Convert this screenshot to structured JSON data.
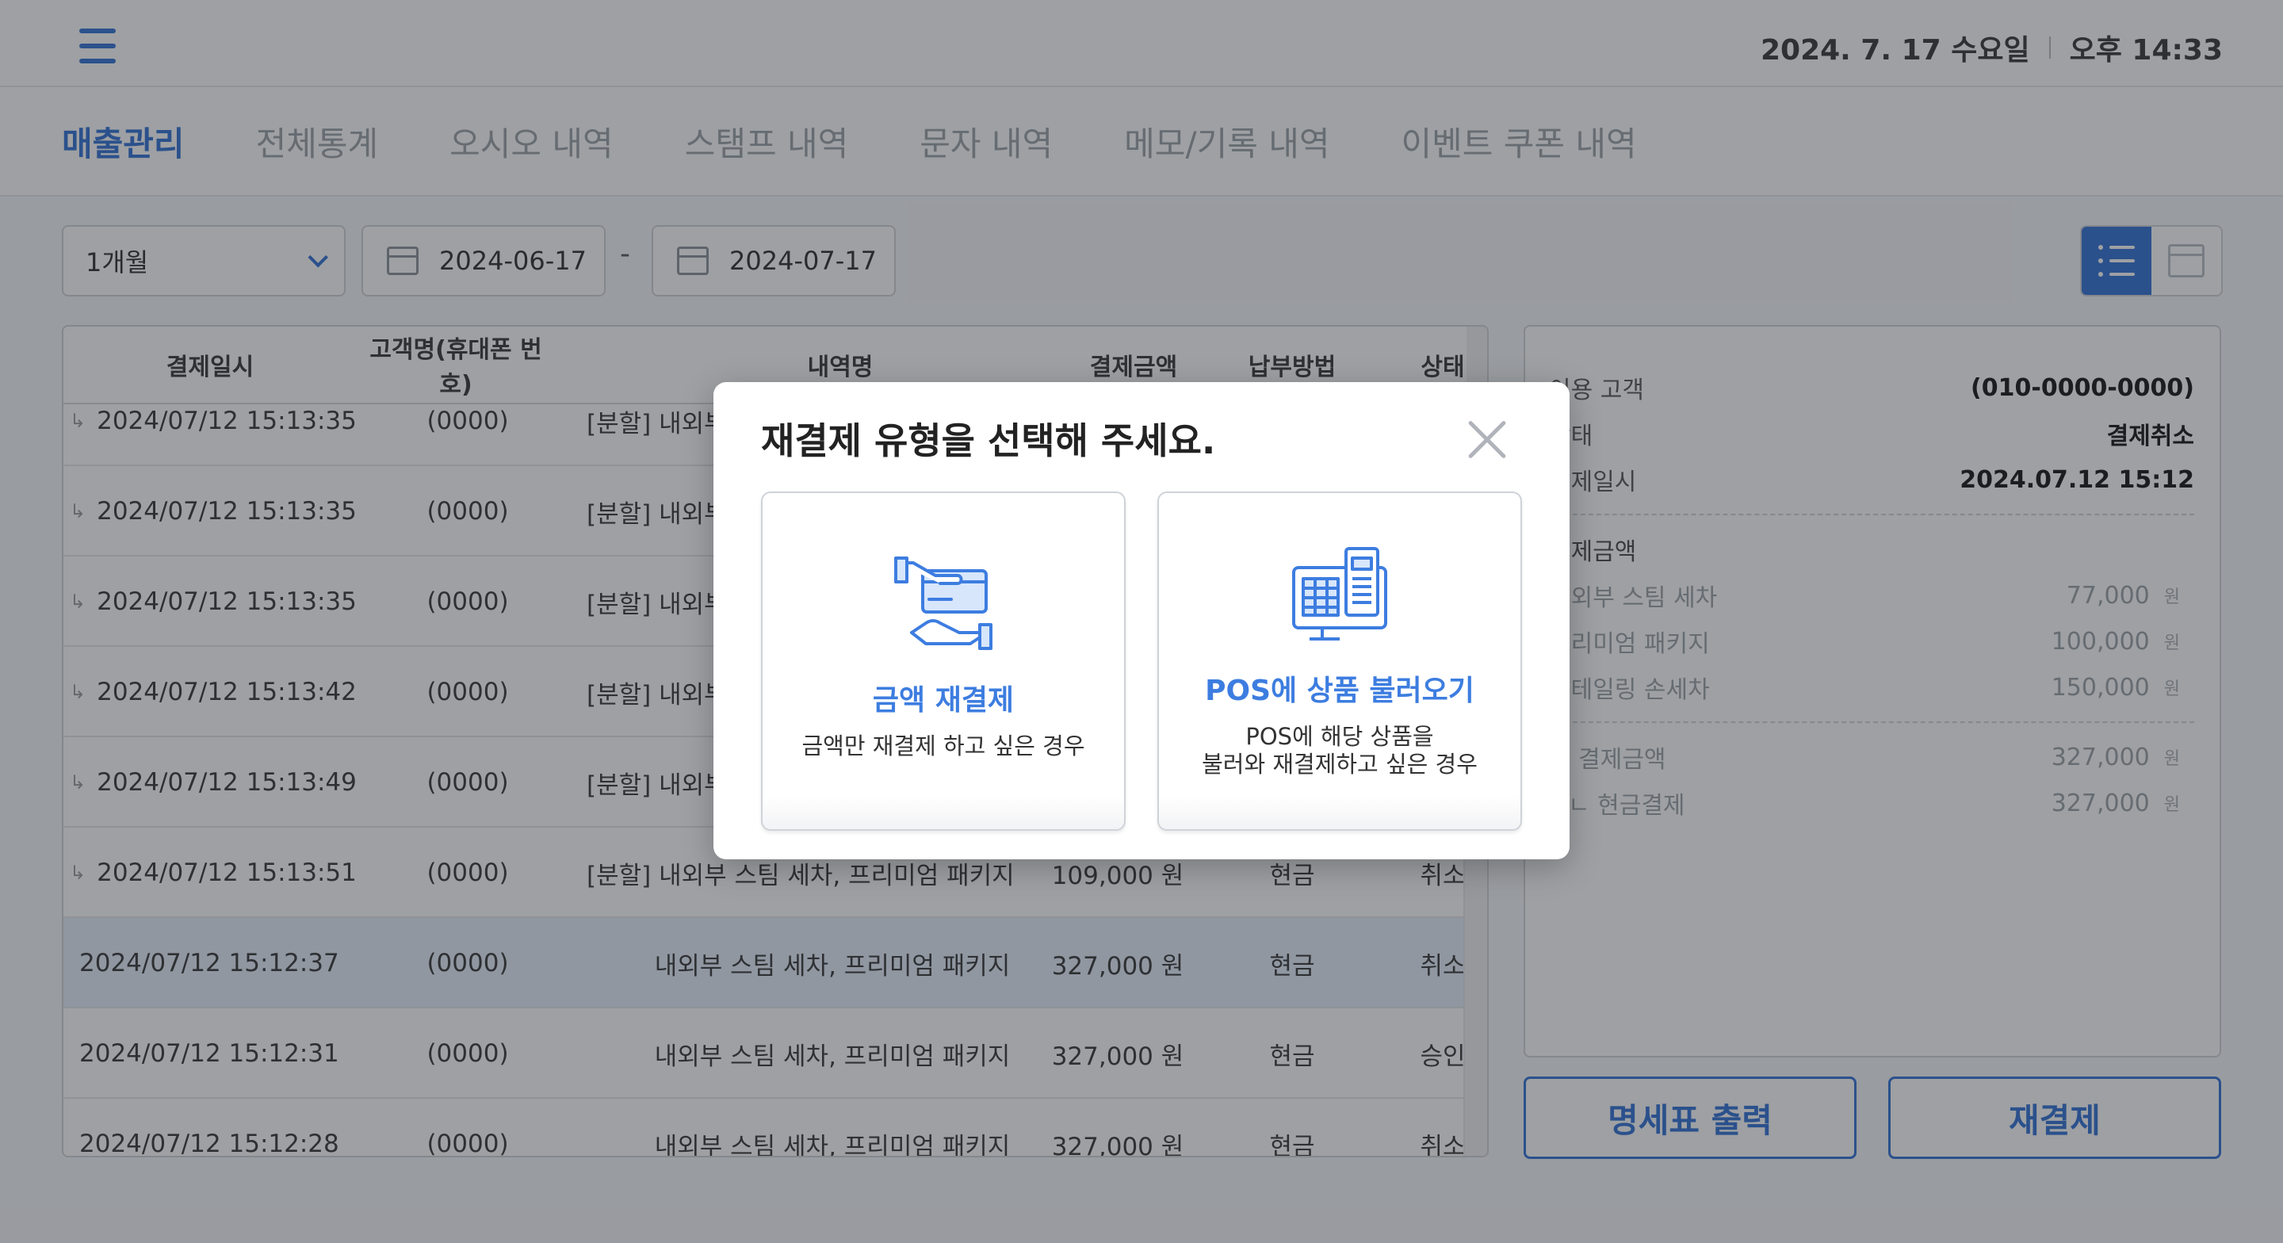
{
  "header": {
    "date": "2024. 7. 17 수요일",
    "time": "오후 14:33",
    "menu_icon": "hamburger-icon"
  },
  "tabs": [
    {
      "label": "매출관리",
      "active": true
    },
    {
      "label": "전체통계"
    },
    {
      "label": "오시오 내역"
    },
    {
      "label": "스탬프 내역"
    },
    {
      "label": "문자 내역"
    },
    {
      "label": "메모/기록 내역"
    },
    {
      "label": "이벤트 쿠폰 내역"
    }
  ],
  "filter": {
    "period": "1개월",
    "start_date": "2024-06-17",
    "end_date": "2024-07-17",
    "separator": "-"
  },
  "table": {
    "headers": [
      "결제일시",
      "고객명(휴대폰 번호)",
      "내역명",
      "결제금액",
      "납부방법",
      "상태"
    ],
    "rows": [
      {
        "datetime": "2024/07/12 15:13:35",
        "customer": "(0000)",
        "item": "[분할] 내외부",
        "amount": "",
        "method": "",
        "status": "",
        "sub": true
      },
      {
        "datetime": "2024/07/12 15:13:35",
        "customer": "(0000)",
        "item": "[분할] 내외부",
        "amount": "",
        "method": "",
        "status": "",
        "sub": true
      },
      {
        "datetime": "2024/07/12 15:13:35",
        "customer": "(0000)",
        "item": "[분할] 내외부",
        "amount": "",
        "method": "",
        "status": "",
        "sub": true
      },
      {
        "datetime": "2024/07/12 15:13:42",
        "customer": "(0000)",
        "item": "[분할] 내외부",
        "amount": "",
        "method": "",
        "status": "",
        "sub": true
      },
      {
        "datetime": "2024/07/12 15:13:49",
        "customer": "(0000)",
        "item": "[분할] 내외부",
        "amount": "",
        "method": "",
        "status": "",
        "sub": true
      },
      {
        "datetime": "2024/07/12 15:13:51",
        "customer": "(0000)",
        "item": "[분할] 내외부 스팀 세차, 프리미엄 패키지",
        "amount": "109,000 원",
        "method": "현금",
        "status": "취소",
        "sub": true
      },
      {
        "datetime": "2024/07/12 15:12:37",
        "customer": "(0000)",
        "item": "내외부 스팀 세차, 프리미엄 패키지",
        "amount": "327,000 원",
        "method": "현금",
        "status": "취소",
        "highlight": true
      },
      {
        "datetime": "2024/07/12 15:12:31",
        "customer": "(0000)",
        "item": "내외부 스팀 세차, 프리미엄 패키지",
        "amount": "327,000 원",
        "method": "현금",
        "status": "승인"
      },
      {
        "datetime": "2024/07/12 15:12:28",
        "customer": "(0000)",
        "item": "내외부 스팀 세차, 프리미엄 패키지",
        "amount": "327,000 원",
        "method": "현금",
        "status": "취소"
      }
    ]
  },
  "detail": {
    "customer_label": "이용 고객",
    "customer_value": "(010-0000-0000)",
    "status_label": "상태",
    "status_value": "결제취소",
    "date_label": "결제일시",
    "date_value": "2024.07.12 15:12",
    "amount_title": "결제금액",
    "items": [
      {
        "name": "내외부 스팀 세차",
        "price": "77,000"
      },
      {
        "name": "프리미엄 패키지",
        "price": "100,000"
      },
      {
        "name": "디테일링 손세차",
        "price": "150,000"
      }
    ],
    "total_label": "총 결제금액",
    "total_value": "327,000",
    "cash_label": "ㄴ 현금결제",
    "cash_value": "327,000",
    "unit": "원"
  },
  "buttons": {
    "receipt": "명세표 출력",
    "repay": "재결제"
  },
  "modal": {
    "title": "재결제 유형을 선택해 주세요.",
    "option1_title": "금액 재결제",
    "option1_desc": "금액만 재결제 하고 싶은 경우",
    "option2_title": "POS에 상품 불러오기",
    "option2_desc": "POS에 해당 상품을\n불러와 재결제하고 싶은 경우"
  },
  "colors": {
    "accent": "#2f6fd6",
    "modal_accent": "#3d7de0",
    "overlay": "#282c34"
  }
}
